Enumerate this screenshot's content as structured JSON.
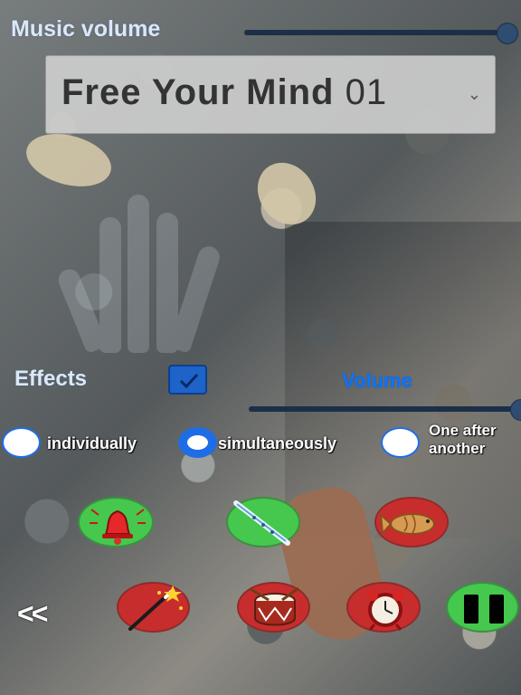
{
  "music_volume": {
    "label": "Music volume",
    "level": 1.0
  },
  "track": {
    "name": "Free Your Mind",
    "number": "01"
  },
  "effects": {
    "label": "Effects",
    "checked": true
  },
  "volume": {
    "label": "Volume",
    "level": 1.0
  },
  "modes": [
    {
      "label": "individually",
      "selected": false
    },
    {
      "label": "simultaneously",
      "selected": true
    },
    {
      "label": "One after another",
      "selected": false
    }
  ],
  "buttons": [
    {
      "icon": "bell-icon",
      "color": "#45c84d"
    },
    {
      "icon": "flute-icon",
      "color": "#45c84d"
    },
    {
      "icon": "fish-icon",
      "color": "#c82d2d"
    },
    {
      "icon": "magic-wand-icon",
      "color": "#c82d2d"
    },
    {
      "icon": "drum-icon",
      "color": "#c82d2d"
    },
    {
      "icon": "alarm-clock-icon",
      "color": "#c82d2d"
    },
    {
      "icon": "pause-icon",
      "color": "#45c84d"
    }
  ],
  "back": {
    "label": "<<"
  }
}
